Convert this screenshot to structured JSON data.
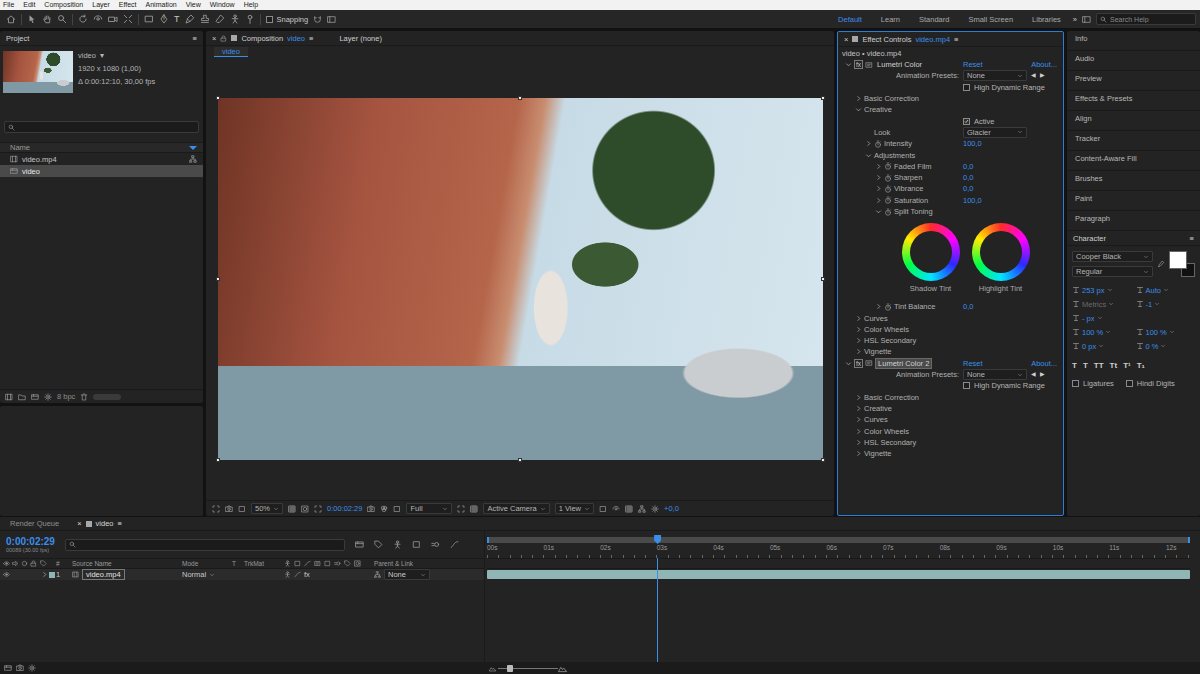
{
  "menu_bar": [
    "File",
    "Edit",
    "Composition",
    "Layer",
    "Effect",
    "Animation",
    "View",
    "Window",
    "Help"
  ],
  "toolbar": {
    "type_tool": "T",
    "snapping": {
      "label": "Snapping",
      "checked": false
    },
    "workspaces": [
      {
        "label": "Default",
        "selected": true
      },
      {
        "label": "Learn",
        "selected": false
      },
      {
        "label": "Standard",
        "selected": false
      },
      {
        "label": "Small Screen",
        "selected": false
      },
      {
        "label": "Libraries",
        "selected": false
      }
    ],
    "more": "»",
    "search": {
      "placeholder": "Search Help"
    }
  },
  "project": {
    "title": "Project",
    "menu": "≡",
    "clip": {
      "name": "video",
      "dropdown": "▾",
      "size": "1920 x 1080 (1,00)",
      "duration": "Δ 0:00:12:10, 30,00 fps"
    },
    "column": "Name",
    "items": [
      {
        "name": "video.mp4",
        "kind": "footage",
        "selected": false
      },
      {
        "name": "video",
        "kind": "composition",
        "selected": true
      }
    ],
    "bpc": "8 bpc"
  },
  "composition": {
    "close": "×",
    "label": "Composition",
    "target": "video",
    "menu": "≡",
    "layer_tab": "Layer (none)",
    "subtab": "video",
    "footer": {
      "zoom": "50%",
      "time": "0:00:02:29",
      "resolution": "Full",
      "camera": "Active Camera",
      "views": "1 View",
      "exposure": "+0,0"
    }
  },
  "effect_controls": {
    "close": "×",
    "title": "Effect Controls",
    "target": "video.mp4",
    "menu": "≡",
    "breadcrumb": "video • video.mp4",
    "effects": [
      {
        "fx": "fx",
        "name": "Lumetri Color",
        "selected": false,
        "expanded": true,
        "reset": "Reset",
        "about": "About...",
        "presets": {
          "label": "Animation Presets:",
          "value": "None",
          "prev": "◀",
          "next": "▶"
        },
        "hdr": {
          "label": "High Dynamic Range",
          "checked": false
        },
        "sections": [
          {
            "kind": "group",
            "label": "Basic Correction",
            "expanded": false
          },
          {
            "kind": "group",
            "label": "Creative",
            "expanded": true,
            "children": [
              {
                "kind": "checkbox",
                "label": "Active",
                "checked": true
              },
              {
                "kind": "dropdown",
                "label": "Look",
                "value": "Glacier"
              },
              {
                "kind": "value",
                "label": "Intensity",
                "value": "100,0",
                "expandable": true,
                "expanded": false
              },
              {
                "kind": "group",
                "label": "Adjustments",
                "expanded": true,
                "children": [
                  {
                    "kind": "value",
                    "label": "Faded Film",
                    "value": "0,0",
                    "expandable": true,
                    "expanded": false
                  },
                  {
                    "kind": "value",
                    "label": "Sharpen",
                    "value": "0,0",
                    "expandable": true,
                    "expanded": false
                  },
                  {
                    "kind": "value",
                    "label": "Vibrance",
                    "value": "0,0",
                    "expandable": true,
                    "expanded": false
                  },
                  {
                    "kind": "value",
                    "label": "Saturation",
                    "value": "100,0",
                    "expandable": true,
                    "expanded": false
                  },
                  {
                    "kind": "wheels",
                    "label": "Split Toning",
                    "expanded": true,
                    "wheels": [
                      "Shadow Tint",
                      "Highlight Tint"
                    ]
                  },
                  {
                    "kind": "value",
                    "label": "Tint Balance",
                    "value": "0,0",
                    "expandable": true,
                    "expanded": false
                  }
                ]
              }
            ]
          },
          {
            "kind": "group",
            "label": "Curves",
            "expanded": false
          },
          {
            "kind": "group",
            "label": "Color Wheels",
            "expanded": false
          },
          {
            "kind": "group",
            "label": "HSL Secondary",
            "expanded": false
          },
          {
            "kind": "group",
            "label": "Vignette",
            "expanded": false
          }
        ]
      },
      {
        "fx": "fx",
        "name": "Lumetri Color 2",
        "selected": true,
        "expanded": true,
        "reset": "Reset",
        "about": "About...",
        "presets": {
          "label": "Animation Presets:",
          "value": "None",
          "prev": "◀",
          "next": "▶"
        },
        "hdr": {
          "label": "High Dynamic Range",
          "checked": false
        },
        "sections": [
          {
            "kind": "group",
            "label": "Basic Correction",
            "expanded": false
          },
          {
            "kind": "group",
            "label": "Creative",
            "expanded": false
          },
          {
            "kind": "group",
            "label": "Curves",
            "expanded": false
          },
          {
            "kind": "group",
            "label": "Color Wheels",
            "expanded": false
          },
          {
            "kind": "group",
            "label": "HSL Secondary",
            "expanded": false
          },
          {
            "kind": "group",
            "label": "Vignette",
            "expanded": false
          }
        ]
      }
    ]
  },
  "right_panel": {
    "panels": [
      "Info",
      "Audio",
      "Preview",
      "Effects & Presets",
      "Align",
      "Tracker",
      "Content-Aware Fill",
      "Brushes",
      "Paint",
      "Paragraph"
    ],
    "character": {
      "title": "Character",
      "menu": "≡",
      "font": "Cooper Black",
      "style": "Regular",
      "size": "253 px",
      "leading": "Auto",
      "kerning": {
        "value": "Metrics",
        "disabled": true
      },
      "tracking": "-1",
      "line_spacing": "- px",
      "vertical_scale": "100 %",
      "horizontal_scale": "100 %",
      "baseline": "0 px",
      "tsume": "0 %",
      "styles": [
        "T",
        "T",
        "TT",
        "Tt",
        "T¹",
        "T₁"
      ],
      "options": [
        {
          "label": "Ligatures",
          "checked": false
        },
        {
          "label": "Hindi Digits",
          "checked": false
        }
      ]
    }
  },
  "timeline": {
    "tabs": [
      {
        "label": "Render Queue",
        "selected": false
      },
      {
        "label": "video",
        "selected": true
      }
    ],
    "close": "×",
    "menu": "≡",
    "time": "0:00:02:29",
    "frames": "00089 (30.00 fps)",
    "columns": [
      "#",
      "Source Name",
      "Mode",
      "T",
      "TrkMat",
      "Parent & Link"
    ],
    "layers": [
      {
        "index": "1",
        "name": "video.mp4",
        "mode": "Normal",
        "fx": "fx",
        "parent": "None",
        "visible": true,
        "expanded": false,
        "color": "#8fb5b4"
      }
    ],
    "ruler": [
      "00s",
      "01s",
      "02s",
      "03s",
      "04s",
      "05s",
      "06s",
      "07s",
      "08s",
      "09s",
      "10s",
      "11s",
      "12s"
    ],
    "playhead": {
      "level": 0.242
    },
    "zoom": {
      "level": 0.2
    }
  }
}
